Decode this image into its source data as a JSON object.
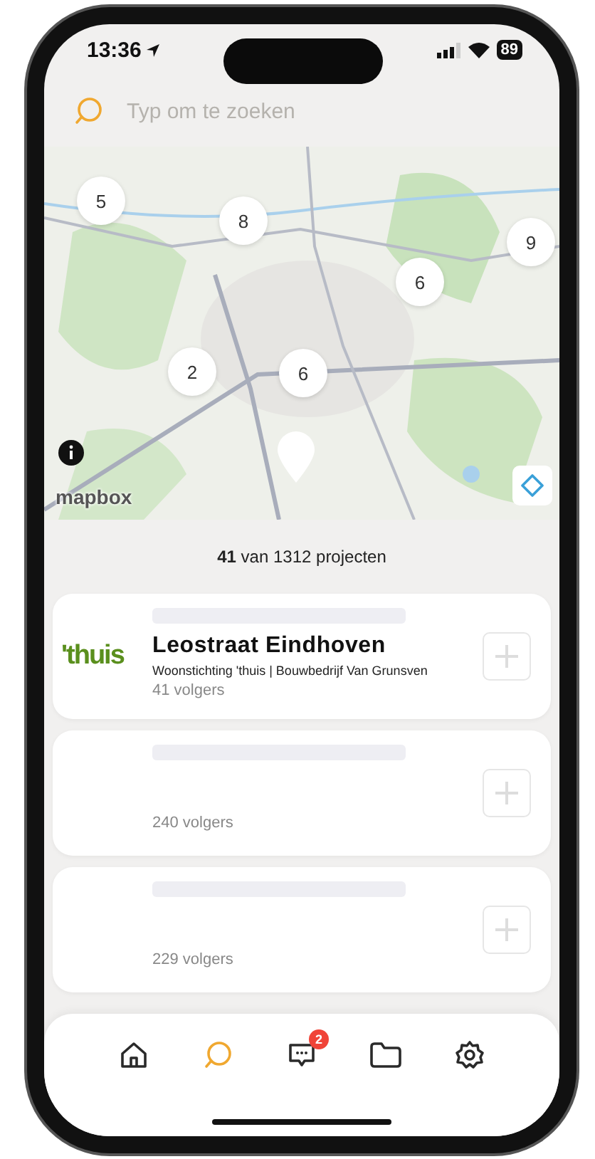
{
  "status_bar": {
    "time": "13:36",
    "battery": "89"
  },
  "search": {
    "placeholder": "Typ om te zoeken"
  },
  "map": {
    "kind": "picture",
    "clusters": [
      {
        "label": "5"
      },
      {
        "label": "8"
      },
      {
        "label": "9"
      },
      {
        "label": "6"
      },
      {
        "label": "2"
      },
      {
        "label": "6"
      }
    ],
    "attribution": "mapbox"
  },
  "result_count": "**41** van 1312 projecten",
  "projects": [
    {
      "logo": "'thuis",
      "title": "Leostraat Eindhoven",
      "subtitle": "Woonstichting 'thuis | Bouwbedrijf Van Grunsven",
      "followers": "41 volgers"
    },
    {
      "followers": "240 volgers"
    },
    {
      "followers": "229 volgers"
    }
  ],
  "tabs": [
    {
      "kind": "home",
      "selected": false
    },
    {
      "kind": "search",
      "selected": true
    },
    {
      "kind": "chat",
      "selected": false,
      "badge": "2"
    },
    {
      "kind": "folder",
      "selected": false
    },
    {
      "kind": "settings",
      "selected": false
    }
  ]
}
